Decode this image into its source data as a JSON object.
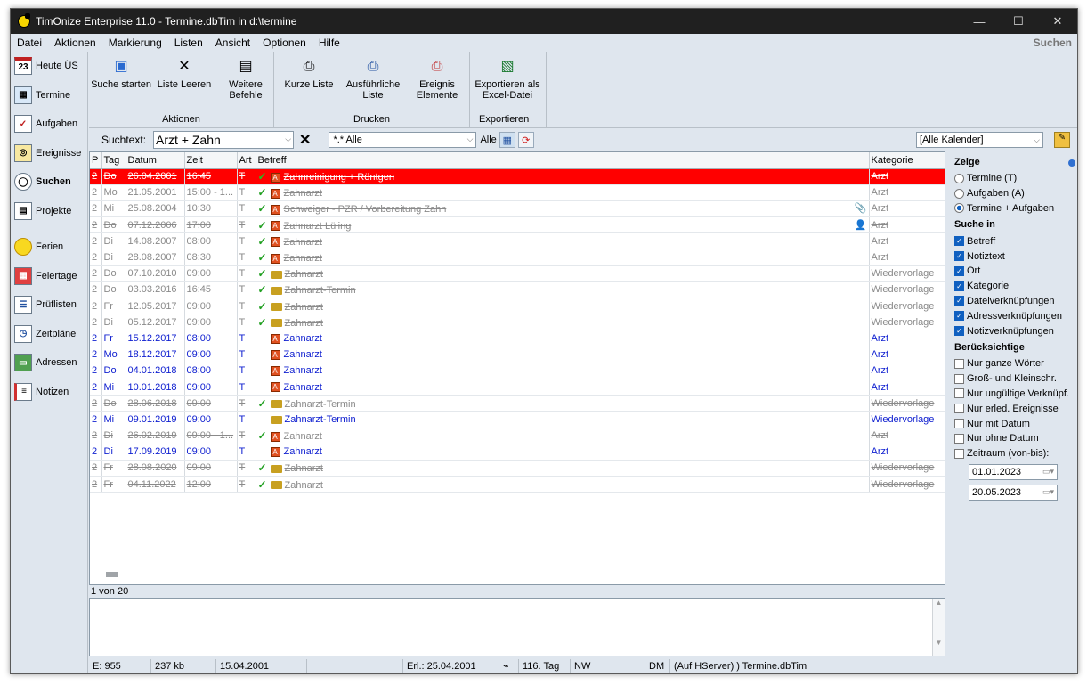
{
  "window": {
    "title": "TimOnize Enterprise 11.0 - Termine.dbTim in d:\\termine",
    "controls": [
      "—",
      "☐",
      "✕"
    ]
  },
  "menu": {
    "items": [
      "Datei",
      "Aktionen",
      "Markierung",
      "Listen",
      "Ansicht",
      "Optionen",
      "Hilfe"
    ],
    "right": "Suchen"
  },
  "sidebar": {
    "items": [
      {
        "label": "Heute ÜS",
        "icon": "calendar-23-icon"
      },
      {
        "label": "Termine",
        "icon": "grid-calendar-icon"
      },
      {
        "label": "Aufgaben",
        "icon": "task-icon"
      },
      {
        "label": "Ereignisse",
        "icon": "events-icon"
      },
      {
        "label": "Suchen",
        "icon": "magnifier-icon"
      },
      {
        "label": "Projekte",
        "icon": "project-icon"
      },
      {
        "label": "Ferien",
        "icon": "sun-icon"
      },
      {
        "label": "Feiertage",
        "icon": "holiday-grid-icon"
      },
      {
        "label": "Prüflisten",
        "icon": "checklist-icon"
      },
      {
        "label": "Zeitpläne",
        "icon": "schedule-icon"
      },
      {
        "label": "Adressen",
        "icon": "address-book-icon"
      },
      {
        "label": "Notizen",
        "icon": "notes-icon"
      }
    ]
  },
  "ribbon": {
    "aktionen": {
      "label": "Aktionen",
      "buttons": [
        "Suche starten",
        "Liste Leeren",
        "Weitere\nBefehle"
      ]
    },
    "drucken": {
      "label": "Drucken",
      "buttons": [
        "Kurze Liste",
        "Ausführliche\nListe",
        "Ereignis\nElemente"
      ]
    },
    "exportieren": {
      "label": "Exportieren",
      "buttons": [
        "Exportieren als\nExcel-Datei"
      ]
    }
  },
  "search": {
    "label": "Suchtext:",
    "value": "Arzt + Zahn",
    "filter": "*.* Alle",
    "alle": "Alle",
    "calendar": "[Alle Kalender]"
  },
  "table": {
    "columns": [
      "P",
      "Tag",
      "Datum",
      "Zeit",
      "Art",
      "Betreff",
      "Kategorie"
    ],
    "rows": [
      {
        "p": "2",
        "tag": "Do",
        "datum": "26.04.2001",
        "zeit": "16:45",
        "art": "T",
        "betreff": "Zahnreinigung + Röntgen",
        "kategorie": "Arzt",
        "state": "sel",
        "check": true,
        "icon": "task"
      },
      {
        "p": "2",
        "tag": "Mo",
        "datum": "21.05.2001",
        "zeit": "15:00 - 1...",
        "art": "T",
        "betreff": "Zahnarzt",
        "kategorie": "Arzt",
        "state": "done",
        "check": true,
        "icon": "task"
      },
      {
        "p": "2",
        "tag": "Mi",
        "datum": "25.08.2004",
        "zeit": "10:30",
        "art": "T",
        "betreff": "Schweiger - PZR / Vorbereitung Zahn",
        "kategorie": "Arzt",
        "state": "done",
        "check": true,
        "icon": "task",
        "extra": "📎"
      },
      {
        "p": "2",
        "tag": "Do",
        "datum": "07.12.2006",
        "zeit": "17:00",
        "art": "T",
        "betreff": "Zahnarzt Lüling",
        "kategorie": "Arzt",
        "state": "done",
        "check": true,
        "icon": "task",
        "extra": "👤"
      },
      {
        "p": "2",
        "tag": "Di",
        "datum": "14.08.2007",
        "zeit": "08:00",
        "art": "T",
        "betreff": "Zahnarzt",
        "kategorie": "Arzt",
        "state": "done",
        "check": true,
        "icon": "task"
      },
      {
        "p": "2",
        "tag": "Di",
        "datum": "28.08.2007",
        "zeit": "08:30",
        "art": "T",
        "betreff": "Zahnarzt",
        "kategorie": "Arzt",
        "state": "done",
        "check": true,
        "icon": "task"
      },
      {
        "p": "2",
        "tag": "Do",
        "datum": "07.10.2010",
        "zeit": "09:00",
        "art": "T",
        "betreff": "Zahnarzt",
        "kategorie": "Wiedervorlage",
        "state": "done",
        "check": true,
        "icon": "hand"
      },
      {
        "p": "2",
        "tag": "Do",
        "datum": "03.03.2016",
        "zeit": "16:45",
        "art": "T",
        "betreff": "Zahnarzt-Termin",
        "kategorie": "Wiedervorlage",
        "state": "done",
        "check": true,
        "icon": "hand"
      },
      {
        "p": "2",
        "tag": "Fr",
        "datum": "12.05.2017",
        "zeit": "09:00",
        "art": "T",
        "betreff": "Zahnarzt",
        "kategorie": "Wiedervorlage",
        "state": "done",
        "check": true,
        "icon": "hand"
      },
      {
        "p": "2",
        "tag": "Di",
        "datum": "05.12.2017",
        "zeit": "09:00",
        "art": "T",
        "betreff": "Zahnarzt",
        "kategorie": "Wiedervorlage",
        "state": "done",
        "check": true,
        "icon": "hand"
      },
      {
        "p": "2",
        "tag": "Fr",
        "datum": "15.12.2017",
        "zeit": "08:00",
        "art": "T",
        "betreff": "Zahnarzt",
        "kategorie": "Arzt",
        "state": "open",
        "check": false,
        "icon": "task"
      },
      {
        "p": "2",
        "tag": "Mo",
        "datum": "18.12.2017",
        "zeit": "09:00",
        "art": "T",
        "betreff": "Zahnarzt",
        "kategorie": "Arzt",
        "state": "open",
        "check": false,
        "icon": "task"
      },
      {
        "p": "2",
        "tag": "Do",
        "datum": "04.01.2018",
        "zeit": "08:00",
        "art": "T",
        "betreff": "Zahnarzt",
        "kategorie": "Arzt",
        "state": "open",
        "check": false,
        "icon": "task"
      },
      {
        "p": "2",
        "tag": "Mi",
        "datum": "10.01.2018",
        "zeit": "09:00",
        "art": "T",
        "betreff": "Zahnarzt",
        "kategorie": "Arzt",
        "state": "open",
        "check": false,
        "icon": "task"
      },
      {
        "p": "2",
        "tag": "Do",
        "datum": "28.06.2018",
        "zeit": "09:00",
        "art": "T",
        "betreff": "Zahnarzt-Termin",
        "kategorie": "Wiedervorlage",
        "state": "done",
        "check": true,
        "icon": "hand"
      },
      {
        "p": "2",
        "tag": "Mi",
        "datum": "09.01.2019",
        "zeit": "09:00",
        "art": "T",
        "betreff": "Zahnarzt-Termin",
        "kategorie": "Wiedervorlage",
        "state": "open",
        "check": false,
        "icon": "hand"
      },
      {
        "p": "2",
        "tag": "Di",
        "datum": "26.02.2019",
        "zeit": "09:00 - 1...",
        "art": "T",
        "betreff": "Zahnarzt",
        "kategorie": "Arzt",
        "state": "done",
        "check": true,
        "icon": "task"
      },
      {
        "p": "2",
        "tag": "Di",
        "datum": "17.09.2019",
        "zeit": "09:00",
        "art": "T",
        "betreff": "Zahnarzt",
        "kategorie": "Arzt",
        "state": "open",
        "check": false,
        "icon": "task"
      },
      {
        "p": "2",
        "tag": "Fr",
        "datum": "28.08.2020",
        "zeit": "09:00",
        "art": "T",
        "betreff": "Zahnarzt",
        "kategorie": "Wiedervorlage",
        "state": "done",
        "check": true,
        "icon": "hand"
      },
      {
        "p": "2",
        "tag": "Fr",
        "datum": "04.11.2022",
        "zeit": "12:00",
        "art": "T",
        "betreff": "Zahnarzt",
        "kategorie": "Wiedervorlage",
        "state": "done",
        "check": true,
        "icon": "hand"
      }
    ]
  },
  "footer": {
    "count": "1 von 20"
  },
  "status": [
    "E: 955",
    "237 kb",
    "15.04.2001",
    "",
    "Erl.: 25.04.2001",
    "116. Tag",
    "NW",
    "DM",
    "(Auf HServer) ) Termine.dbTim"
  ],
  "panel": {
    "zeige": {
      "title": "Zeige",
      "options": [
        "Termine (T)",
        "Aufgaben (A)",
        "Termine + Aufgaben"
      ],
      "selected": 2
    },
    "suche_in": {
      "title": "Suche in",
      "options": [
        "Betreff",
        "Notiztext",
        "Ort",
        "Kategorie",
        "Dateiverknüpfungen",
        "Adressverknüpfungen",
        "Notizverknüpfungen"
      ],
      "checked": [
        true,
        true,
        true,
        true,
        true,
        true,
        true
      ]
    },
    "beruecksichtige": {
      "title": "Berücksichtige",
      "options": [
        "Nur ganze Wörter",
        "Groß- und Kleinschr.",
        "Nur ungültige Verknüpf.",
        "Nur erled. Ereignisse",
        "Nur mit Datum",
        "Nur ohne Datum",
        "Zeitraum (von-bis):"
      ],
      "checked": [
        false,
        false,
        false,
        false,
        false,
        false,
        false
      ]
    },
    "date_from": "01.01.2023",
    "date_to": "20.05.2023"
  },
  "colors": {
    "selected_row": "#ff0000",
    "open_text": "#1020d0",
    "done_text": "#8a8a8a",
    "check": "#22a022"
  }
}
